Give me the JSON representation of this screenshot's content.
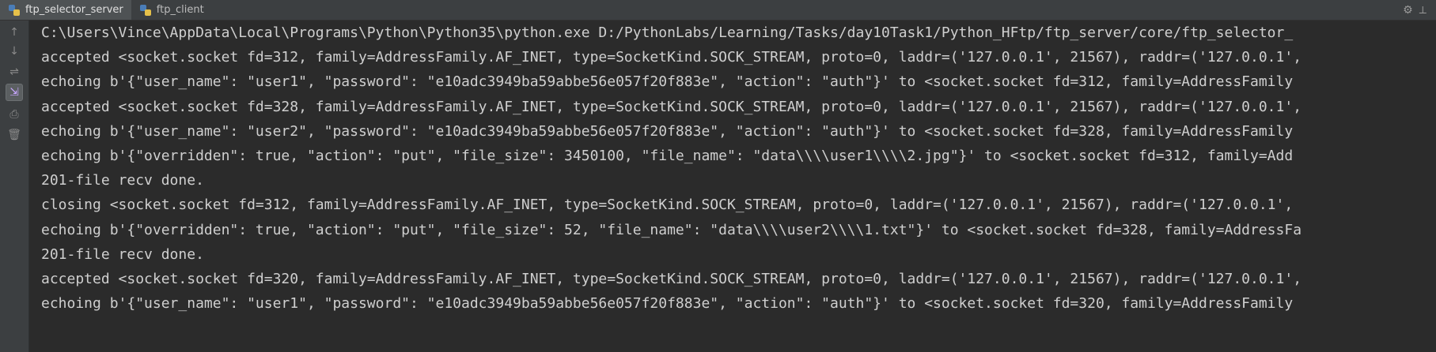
{
  "tabs": [
    {
      "label": "ftp_selector_server",
      "active": true,
      "icon": "python-file-icon"
    },
    {
      "label": "ftp_client",
      "active": false,
      "icon": "python-file-icon"
    }
  ],
  "toolbar_right": {
    "icons": [
      "gear-icon",
      "minimize-panel-icon"
    ]
  },
  "gutter": {
    "icons": [
      "up-arrow-icon",
      "down-arrow-icon",
      "soft-wrap-icon",
      "scroll-to-end-icon",
      "print-icon",
      "trash-icon"
    ]
  },
  "console": {
    "lines": [
      "C:\\Users\\Vince\\AppData\\Local\\Programs\\Python\\Python35\\python.exe D:/PythonLabs/Learning/Tasks/day10Task1/Python_HFtp/ftp_server/core/ftp_selector_",
      "accepted <socket.socket fd=312, family=AddressFamily.AF_INET, type=SocketKind.SOCK_STREAM, proto=0, laddr=('127.0.0.1', 21567), raddr=('127.0.0.1',",
      "echoing b'{\"user_name\": \"user1\", \"password\": \"e10adc3949ba59abbe56e057f20f883e\", \"action\": \"auth\"}' to <socket.socket fd=312, family=AddressFamily",
      "accepted <socket.socket fd=328, family=AddressFamily.AF_INET, type=SocketKind.SOCK_STREAM, proto=0, laddr=('127.0.0.1', 21567), raddr=('127.0.0.1',",
      "echoing b'{\"user_name\": \"user2\", \"password\": \"e10adc3949ba59abbe56e057f20f883e\", \"action\": \"auth\"}' to <socket.socket fd=328, family=AddressFamily",
      "echoing b'{\"overridden\": true, \"action\": \"put\", \"file_size\": 3450100, \"file_name\": \"data\\\\\\\\user1\\\\\\\\2.jpg\"}' to <socket.socket fd=312, family=Add",
      "201-file recv done.",
      "closing <socket.socket fd=312, family=AddressFamily.AF_INET, type=SocketKind.SOCK_STREAM, proto=0, laddr=('127.0.0.1', 21567), raddr=('127.0.0.1',",
      "echoing b'{\"overridden\": true, \"action\": \"put\", \"file_size\": 52, \"file_name\": \"data\\\\\\\\user2\\\\\\\\1.txt\"}' to <socket.socket fd=328, family=AddressFa",
      "201-file recv done.",
      "accepted <socket.socket fd=320, family=AddressFamily.AF_INET, type=SocketKind.SOCK_STREAM, proto=0, laddr=('127.0.0.1', 21567), raddr=('127.0.0.1',",
      "echoing b'{\"user_name\": \"user1\", \"password\": \"e10adc3949ba59abbe56e057f20f883e\", \"action\": \"auth\"}' to <socket.socket fd=320, family=AddressFamily"
    ]
  },
  "colors": {
    "background": "#2b2b2b",
    "text": "#cfcfcf",
    "panel": "#3c3f41"
  }
}
